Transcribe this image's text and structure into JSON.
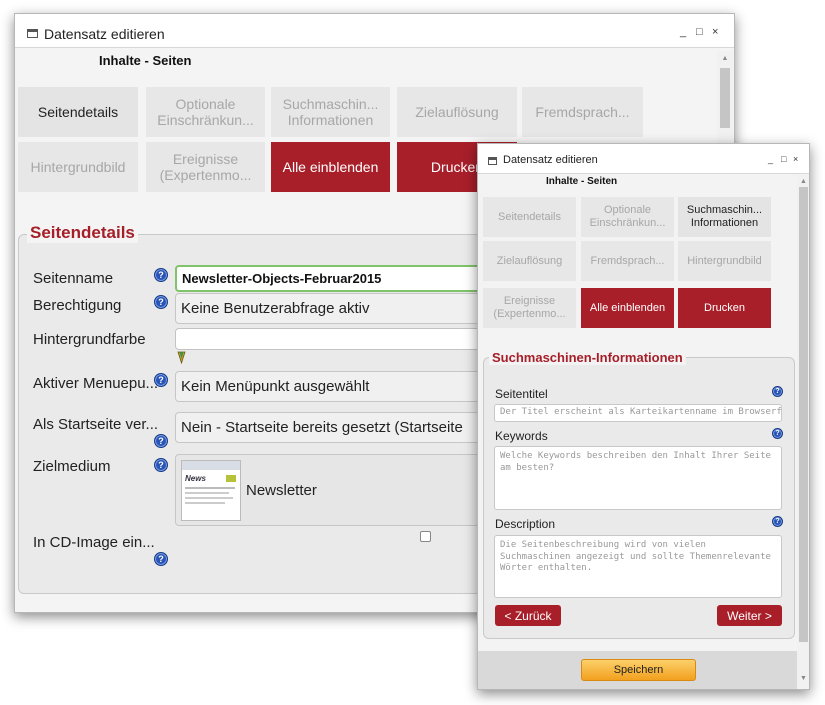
{
  "back_window": {
    "title": "Datensatz editieren",
    "subtitle": "Inhalte - Seiten",
    "controls": {
      "minimize": "_",
      "maximize": "□",
      "close": "×"
    },
    "tiles": [
      {
        "label": "Seitendetails",
        "state": "active"
      },
      {
        "label": "Optionale Einschränkun...",
        "state": "inactive"
      },
      {
        "label": "Suchmaschin... Informationen",
        "state": "inactive"
      },
      {
        "label": "Zielauflösung",
        "state": "inactive"
      },
      {
        "label": "Fremdsprach...",
        "state": "inactive"
      },
      {
        "label": "Hintergrundbild",
        "state": "inactive"
      },
      {
        "label": "Ereignisse (Expertenmo...",
        "state": "inactive"
      },
      {
        "label": "Alle einblenden",
        "state": "red"
      },
      {
        "label": "Drucken",
        "state": "red"
      }
    ],
    "section_title": "Seitendetails",
    "fields": {
      "seitenname": {
        "label": "Seitenname",
        "value": "Newsletter-Objects-Februar2015"
      },
      "berechtigung": {
        "label": "Berechtigung",
        "value": "Keine Benutzerabfrage aktiv"
      },
      "hintergrundfarbe": {
        "label": "Hintergrundfarbe",
        "value": ""
      },
      "aktiver_menuepunkt": {
        "label": "Aktiver Menuepu...",
        "value": "Kein Menüpunkt ausgewählt"
      },
      "startseite": {
        "label": "Als Startseite ver...",
        "value": "Nein - Startseite bereits gesetzt (Startseite"
      },
      "zielmedium": {
        "label": "Zielmedium",
        "value": "Newsletter",
        "thumb_text": "News"
      },
      "cd_image": {
        "label": "In CD-Image ein...",
        "checked": false
      }
    }
  },
  "front_window": {
    "title": "Datensatz editieren",
    "subtitle": "Inhalte - Seiten",
    "controls": {
      "minimize": "_",
      "maximize": "□",
      "close": "×"
    },
    "tiles": [
      {
        "label": "Seitendetails",
        "state": "inactive"
      },
      {
        "label": "Optionale Einschränkun...",
        "state": "inactive"
      },
      {
        "label": "Suchmaschin... Informationen",
        "state": "active"
      },
      {
        "label": "Zielauflösung",
        "state": "inactive"
      },
      {
        "label": "Fremdsprach...",
        "state": "inactive"
      },
      {
        "label": "Hintergrundbild",
        "state": "inactive"
      },
      {
        "label": "Ereignisse (Expertenmo...",
        "state": "inactive"
      },
      {
        "label": "Alle einblenden",
        "state": "red"
      },
      {
        "label": "Drucken",
        "state": "red"
      }
    ],
    "section_title": "Suchmaschinen-Informationen",
    "fields": {
      "seitentitel": {
        "label": "Seitentitel",
        "placeholder": "Der Titel erscheint als Karteikartenname im Browserfenster"
      },
      "keywords": {
        "label": "Keywords",
        "placeholder": "Welche Keywords beschreiben den Inhalt Ihrer Seite am besten?"
      },
      "description": {
        "label": "Description",
        "placeholder": "Die Seitenbeschreibung wird von vielen Suchmaschinen angezeigt und sollte Themenrelevante Wörter enthalten."
      }
    },
    "buttons": {
      "back": "< Zurück",
      "next": "Weiter >",
      "save": "Speichern"
    }
  },
  "colors": {
    "accent_red": "#a81f2a",
    "help_blue": "#2a55b6",
    "save_orange": "#f6a823"
  },
  "help_icon_glyph": "?"
}
